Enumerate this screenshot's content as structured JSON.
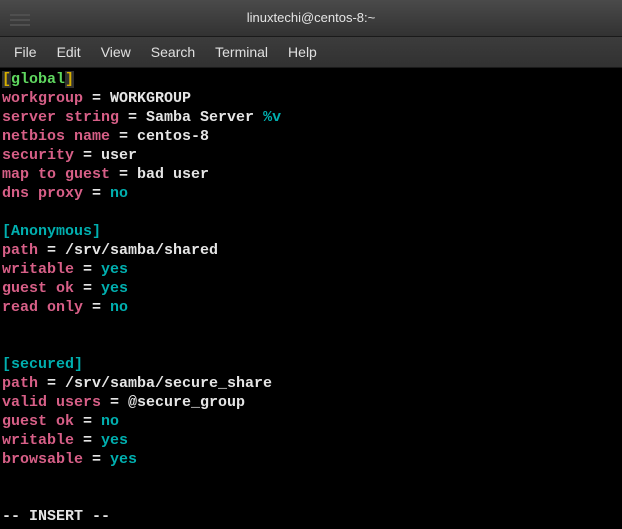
{
  "title": "linuxtechi@centos-8:~",
  "menu": {
    "file": "File",
    "edit": "Edit",
    "view": "View",
    "search": "Search",
    "terminal": "Terminal",
    "help": "Help"
  },
  "conf": {
    "g_open": "[",
    "g_label": "global",
    "g_close": "]",
    "workgroup_k": "workgroup",
    "workgroup_eq": " = WORKGROUP",
    "server_k": "server string",
    "server_eq": " = Samba Server ",
    "server_var": "%v",
    "netbios_k": "netbios name",
    "netbios_eq": " = centos-8",
    "security_k": "security",
    "security_eq": " = user",
    "map_k": "map to guest",
    "map_eq": " = bad user",
    "dns_k": "dns proxy",
    "dns_eq": " = ",
    "dns_v": "no",
    "anon": "[Anonymous]",
    "a_path_k": "path",
    "a_path_eq": " = /srv/samba/shared",
    "a_wr_k": "writable",
    "a_wr_eq": " = ",
    "a_wr_v": "yes",
    "a_go_k": "guest ok",
    "a_go_eq": " = ",
    "a_go_v": "yes",
    "a_ro_k": "read only",
    "a_ro_eq": " = ",
    "a_ro_v": "no",
    "sec": "[secured]",
    "s_path_k": "path",
    "s_path_eq": " = /srv/samba/secure_share",
    "s_vu_k": "valid users",
    "s_vu_eq": " = @secure_group",
    "s_go_k": "guest ok",
    "s_go_eq": " = ",
    "s_go_v": "no",
    "s_wr_k": "writable",
    "s_wr_eq": " = ",
    "s_wr_v": "yes",
    "s_br_k": "browsable",
    "s_br_eq": " = ",
    "s_br_v": "yes"
  },
  "mode": "-- INSERT --"
}
